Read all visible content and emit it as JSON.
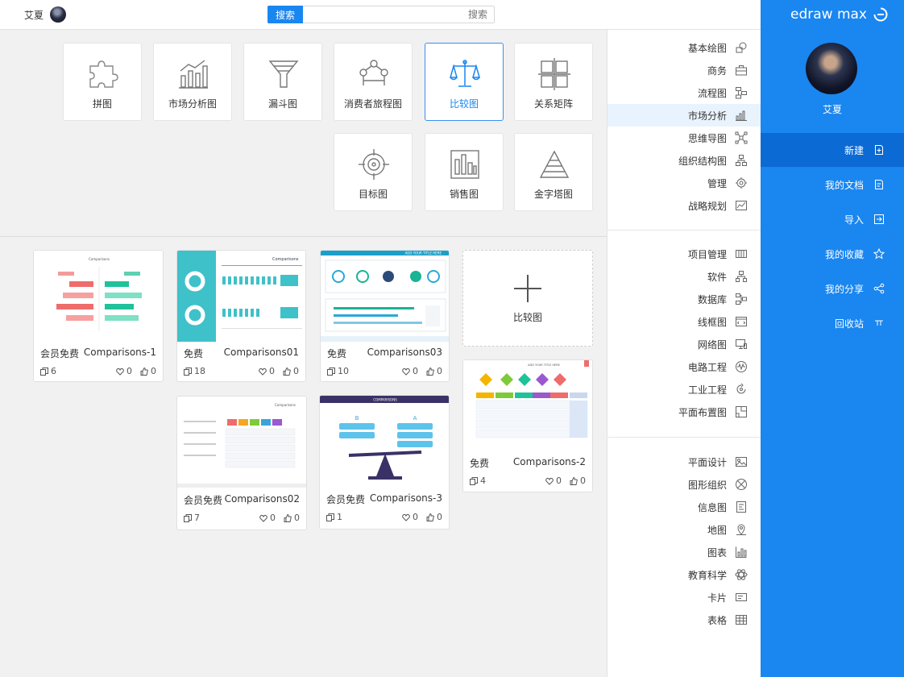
{
  "topbar": {
    "username": "艾夏",
    "search_button": "搜索",
    "search_placeholder": "搜索"
  },
  "brand": {
    "name": "edraw max"
  },
  "nav": {
    "username": "艾夏",
    "items": [
      {
        "label": "新建",
        "icon": "new-file-icon",
        "active": true
      },
      {
        "label": "我的文档",
        "icon": "documents-icon",
        "active": false
      },
      {
        "label": "导入",
        "icon": "import-icon",
        "active": false
      },
      {
        "label": "我的收藏",
        "icon": "star-icon",
        "active": false
      },
      {
        "label": "我的分享",
        "icon": "share-icon",
        "active": false
      },
      {
        "label": "回收站",
        "icon": "trash-icon",
        "active": false
      }
    ]
  },
  "categories": {
    "group1": [
      {
        "label": "基本绘图",
        "icon": "basic-shapes-icon"
      },
      {
        "label": "商务",
        "icon": "briefcase-icon"
      },
      {
        "label": "流程图",
        "icon": "flowchart-icon"
      },
      {
        "label": "市场分析",
        "icon": "market-chart-icon",
        "active": true
      },
      {
        "label": "思维导图",
        "icon": "mindmap-icon"
      },
      {
        "label": "组织结构图",
        "icon": "org-chart-icon"
      },
      {
        "label": "管理",
        "icon": "gear-people-icon"
      },
      {
        "label": "战略规划",
        "icon": "strategy-icon"
      }
    ],
    "group2": [
      {
        "label": "项目管理",
        "icon": "project-icon"
      },
      {
        "label": "软件",
        "icon": "software-icon"
      },
      {
        "label": "数据库",
        "icon": "database-icon"
      },
      {
        "label": "线框图",
        "icon": "wireframe-icon"
      },
      {
        "label": "网络图",
        "icon": "network-icon"
      },
      {
        "label": "电路工程",
        "icon": "circuit-icon"
      },
      {
        "label": "工业工程",
        "icon": "industrial-icon"
      },
      {
        "label": "平面布置图",
        "icon": "floorplan-icon"
      }
    ],
    "group3": [
      {
        "label": "平面设计",
        "icon": "graphic-design-icon"
      },
      {
        "label": "图形组织",
        "icon": "graphic-organizer-icon"
      },
      {
        "label": "信息图",
        "icon": "infographic-icon"
      },
      {
        "label": "地图",
        "icon": "map-pin-icon"
      },
      {
        "label": "图表",
        "icon": "chart-icon"
      },
      {
        "label": "教育科学",
        "icon": "science-icon"
      },
      {
        "label": "卡片",
        "icon": "card-icon"
      },
      {
        "label": "表格",
        "icon": "table-icon"
      }
    ]
  },
  "types": [
    {
      "label": "关系矩阵",
      "icon": "matrix-icon"
    },
    {
      "label": "比较图",
      "icon": "balance-scale-icon",
      "selected": true
    },
    {
      "label": "消费者旅程图",
      "icon": "journey-icon"
    },
    {
      "label": "漏斗图",
      "icon": "funnel-icon"
    },
    {
      "label": "市场分析图",
      "icon": "market-bars-icon"
    },
    {
      "label": "拼图",
      "icon": "puzzle-icon"
    },
    {
      "label": "金字塔图",
      "icon": "pyramid-icon"
    },
    {
      "label": "销售图",
      "icon": "sales-bars-icon"
    },
    {
      "label": "目标图",
      "icon": "target-icon"
    }
  ],
  "new_card": {
    "label": "比较图"
  },
  "templates": [
    {
      "name": "Comparisons03",
      "tag": "免费",
      "likes": "0",
      "favorites": "0",
      "copies": "10"
    },
    {
      "name": "Comparisons01",
      "tag": "免费",
      "likes": "0",
      "favorites": "0",
      "copies": "18"
    },
    {
      "name": "Comparisons-1",
      "tag": "会员免费",
      "likes": "0",
      "favorites": "0",
      "copies": "6"
    },
    {
      "name": "Comparisons-2",
      "tag": "免费",
      "likes": "0",
      "favorites": "0",
      "copies": "4"
    },
    {
      "name": "Comparisons-3",
      "tag": "会员免费",
      "likes": "0",
      "favorites": "0",
      "copies": "1"
    },
    {
      "name": "Comparisons02",
      "tag": "会员免费",
      "likes": "0",
      "favorites": "0",
      "copies": "7"
    }
  ],
  "thumb_texts": {
    "t1_title": "ADD YOUR TITLE HERE",
    "t2_title": "Comparisons",
    "t3_title": "Comparisons",
    "t4_title": "ADD YOUR TITLE HERE",
    "t5_title": "COMPARISONS",
    "t5_a": "A",
    "t5_b": "B",
    "t6_title": "Comparisons"
  },
  "colors": {
    "brand_blue": "#1a86f0",
    "nav_active": "#0b6ad3",
    "active_row": "#e9f3fd"
  }
}
